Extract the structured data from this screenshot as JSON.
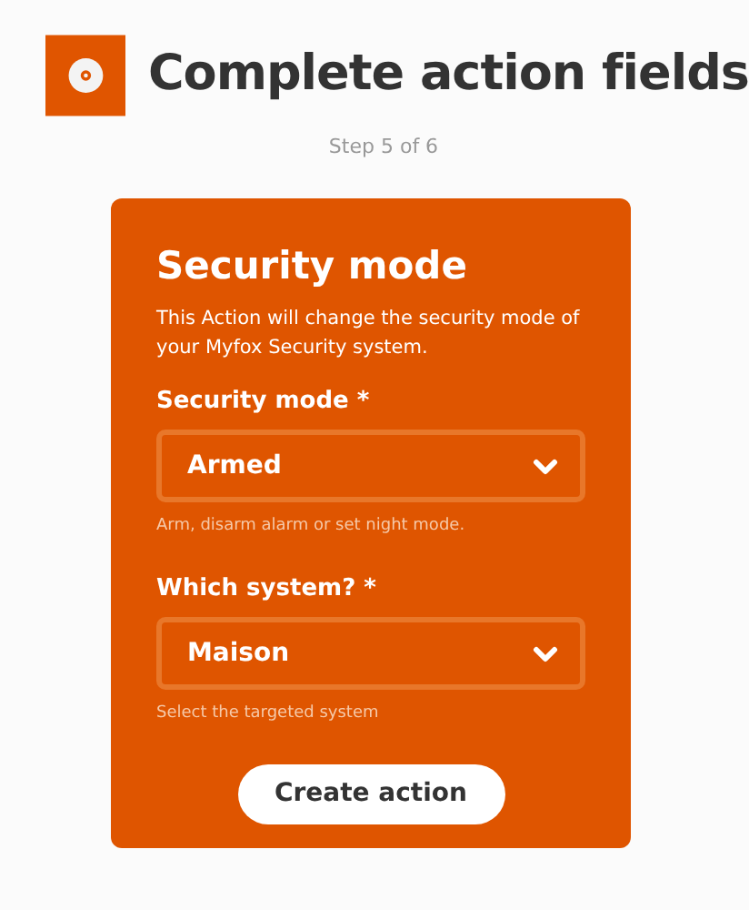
{
  "header": {
    "title": "Complete action fields",
    "step": "Step 5 of 6"
  },
  "card": {
    "title": "Security mode",
    "description": "This Action will change the security mode of your Myfox Security system.",
    "fields": [
      {
        "label": "Security mode *",
        "value": "Armed",
        "hint": "Arm, disarm alarm or set night mode."
      },
      {
        "label": "Which system? *",
        "value": "Maison",
        "hint": "Select the targeted system"
      }
    ],
    "button": "Create action"
  }
}
